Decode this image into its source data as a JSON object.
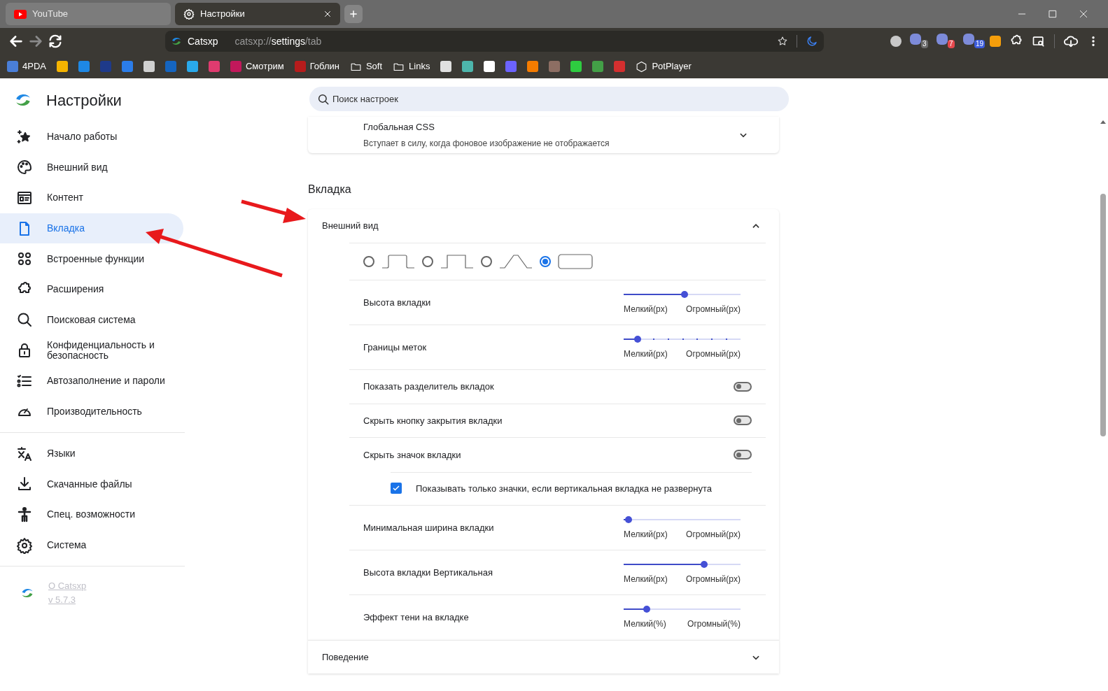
{
  "browser": {
    "tabs": [
      {
        "title": "YouTube",
        "kind": "youtube",
        "selected": false
      },
      {
        "title": "Настройки",
        "kind": "settings",
        "selected": true
      }
    ],
    "site_label": "Catsxp",
    "url": "catsxp://**settings**/tab",
    "extension_badges": [
      {
        "kind": "circle"
      },
      {
        "kind": "badge",
        "count": "3",
        "color": "#6b6b6b"
      },
      {
        "kind": "badge",
        "count": "7",
        "color": "#e5484d"
      },
      {
        "kind": "badge",
        "count": "19",
        "color": "#3b5bdb"
      },
      {
        "kind": "plain"
      }
    ],
    "bookmarks": [
      {
        "label": "4PDA",
        "kind": "site",
        "color": "#4a7fd8"
      },
      {
        "kind": "site",
        "color": "#f5b400"
      },
      {
        "kind": "site",
        "color": "#1e88e5"
      },
      {
        "kind": "site",
        "color": "#1e3a8a"
      },
      {
        "kind": "site",
        "color": "#2b7de9"
      },
      {
        "kind": "site",
        "color": "#d0d0d0"
      },
      {
        "kind": "site",
        "color": "#1565c0"
      },
      {
        "kind": "site",
        "color": "#29a9eb"
      },
      {
        "kind": "site",
        "color": "#e03b6f"
      },
      {
        "label": "Смотрим",
        "kind": "site",
        "color": "#c2185b"
      },
      {
        "label": "Гоблин",
        "kind": "site",
        "color": "#b71c1c"
      },
      {
        "label": "Soft",
        "kind": "folder"
      },
      {
        "label": "Links",
        "kind": "folder"
      },
      {
        "kind": "site",
        "color": "#e0e0e0"
      },
      {
        "kind": "site",
        "color": "#4db6ac"
      },
      {
        "kind": "site",
        "color": "#ffffff"
      },
      {
        "kind": "site",
        "color": "#6c63ff"
      },
      {
        "kind": "site",
        "color": "#f57c00"
      },
      {
        "kind": "site",
        "color": "#8d6e63"
      },
      {
        "kind": "site",
        "color": "#2ecc40"
      },
      {
        "kind": "site",
        "color": "#43a047"
      },
      {
        "kind": "site",
        "color": "#d32f2f"
      },
      {
        "label": "PotPlayer",
        "kind": "folder_js"
      }
    ]
  },
  "sidebar": {
    "title": "Настройки",
    "items": [
      {
        "label": "Начало работы",
        "selected": false
      },
      {
        "label": "Внешний вид",
        "selected": false
      },
      {
        "label": "Контент",
        "selected": false
      },
      {
        "label": "Вкладка",
        "selected": true
      },
      {
        "label": "Встроенные функции",
        "selected": false
      },
      {
        "label": "Расширения",
        "selected": false
      },
      {
        "label": "Поисковая система",
        "selected": false
      },
      {
        "label": "Конфиденциальность и безопасность",
        "selected": false
      },
      {
        "label": "Автозаполнение и пароли",
        "selected": false
      },
      {
        "label": "Производительность",
        "selected": false
      }
    ],
    "items_2": [
      {
        "label": "Языки",
        "selected": false
      },
      {
        "label": "Скачанные файлы",
        "selected": false
      },
      {
        "label": "Спец. возможности",
        "selected": false
      },
      {
        "label": "Система",
        "selected": false
      }
    ],
    "about": {
      "name": "О Catsxp",
      "version": "v 5.7.3"
    }
  },
  "search": {
    "placeholder": "Поиск настроек"
  },
  "global_css": {
    "title": "Глобальная CSS",
    "description": "Вступает в силу, когда фоновое изображение не отображается",
    "expanded": false
  },
  "section_title": "Вкладка",
  "appearance": {
    "title": "Внешний вид",
    "expanded": true,
    "tab_shapes": [
      {
        "selected": false
      },
      {
        "selected": false
      },
      {
        "selected": false
      },
      {
        "selected": true
      }
    ],
    "rows": [
      {
        "kind": "slider",
        "label": "Высота вкладки",
        "level": 0.52,
        "stepped": false,
        "min_label": "Мелкий(px)",
        "max_label": "Огромный(px)"
      },
      {
        "kind": "slider",
        "label": "Границы меток",
        "level": 0.12,
        "stepped": true,
        "min_label": "Мелкий(px)",
        "max_label": "Огромный(px)"
      },
      {
        "kind": "toggle",
        "label": "Показать разделитель вкладок",
        "on": false
      },
      {
        "kind": "toggle",
        "label": "Скрыть кнопку закрытия вкладки",
        "on": false
      },
      {
        "kind": "toggle",
        "label": "Скрыть значок вкладки",
        "on": false
      },
      {
        "kind": "checkbox",
        "label": "Показывать только значки, если вертикальная вкладка не развернута",
        "checked": true
      },
      {
        "kind": "slider",
        "label": "Минимальная ширина вкладки",
        "level": 0.04,
        "stepped": false,
        "min_label": "Мелкий(px)",
        "max_label": "Огромный(px)"
      },
      {
        "kind": "slider",
        "label": "Высота вкладки Вертикальная",
        "level": 0.69,
        "stepped": false,
        "min_label": "Мелкий(px)",
        "max_label": "Огромный(px)"
      },
      {
        "kind": "slider",
        "label": "Эффект тени на вкладке",
        "level": 0.2,
        "stepped": false,
        "min_label": "Мелкий(%)",
        "max_label": "Огромный(%)"
      }
    ]
  },
  "behavior": {
    "title": "Поведение",
    "expanded": false
  }
}
